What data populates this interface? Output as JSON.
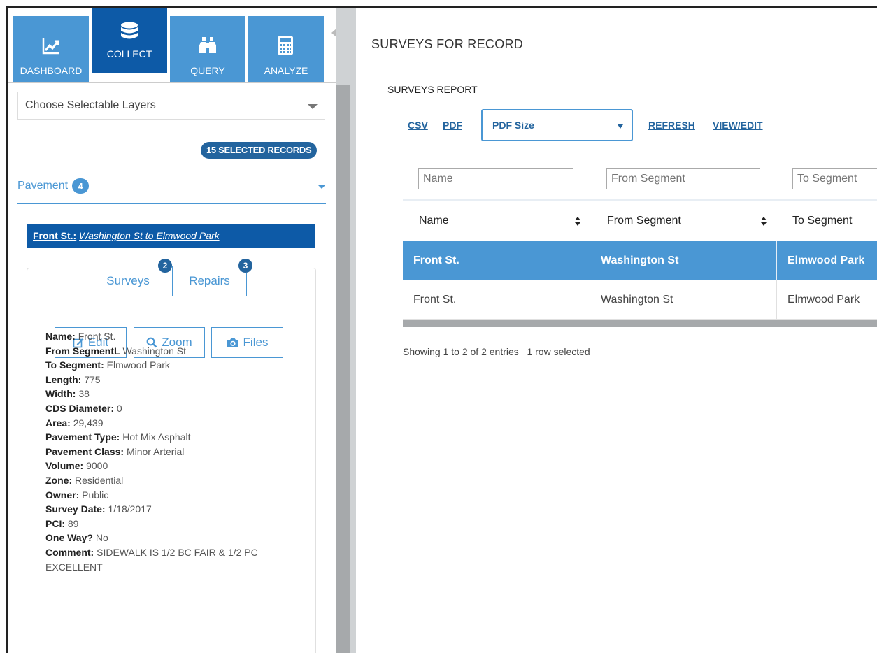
{
  "nav": {
    "dashboard": "DASHBOARD",
    "collect": "COLLECT",
    "query": "QUERY",
    "analyze": "ANALYZE"
  },
  "layers": {
    "placeholder": "Choose Selectable Layers"
  },
  "selected_records": "15 SELECTED RECORDS",
  "group": {
    "name": "Pavement",
    "count": "4"
  },
  "record": {
    "name": "Front St.:",
    "segment": "Washington St to Elmwood Park"
  },
  "actions": {
    "surveys": "Surveys",
    "surveys_count": "2",
    "repairs": "Repairs",
    "repairs_count": "3",
    "edit": "Edit",
    "zoom": "Zoom",
    "files": "Files"
  },
  "details": [
    {
      "label": "Name:",
      "value": "Front St."
    },
    {
      "label": "From SegmentL",
      "value": "Washington St"
    },
    {
      "label": "To Segment:",
      "value": "Elmwood Park"
    },
    {
      "label": "Length:",
      "value": "775"
    },
    {
      "label": "Width:",
      "value": "38"
    },
    {
      "label": "CDS Diameter:",
      "value": "0"
    },
    {
      "label": "Area:",
      "value": "29,439"
    },
    {
      "label": "Pavement Type:",
      "value": "Hot Mix Asphalt"
    },
    {
      "label": "Pavement Class:",
      "value": "Minor Arterial"
    },
    {
      "label": "Volume:",
      "value": "9000"
    },
    {
      "label": "Zone:",
      "value": "Residential"
    },
    {
      "label": "Owner:",
      "value": "Public"
    },
    {
      "label": "Survey Date:",
      "value": "1/18/2017"
    },
    {
      "label": "PCI:",
      "value": "89"
    },
    {
      "label": "One Way?",
      "value": "No"
    },
    {
      "label": "Comment:",
      "value": "SIDEWALK IS 1/2 BC FAIR & 1/2 PC EXCELLENT"
    }
  ],
  "panel": {
    "title": "SURVEYS FOR RECORD",
    "report_title": "SURVEYS REPORT",
    "csv": "CSV",
    "pdf": "PDF",
    "pdf_size": "PDF Size",
    "refresh": "REFRESH",
    "view_edit": "VIEW/EDIT"
  },
  "table": {
    "filters": [
      "Name",
      "From Segment",
      "To Segment"
    ],
    "headers": [
      "Name",
      "From Segment",
      "To Segment"
    ],
    "rows": [
      [
        "Front St.",
        "Washington St",
        "Elmwood Park"
      ],
      [
        "Front St.",
        "Washington St",
        "Elmwood Park"
      ]
    ],
    "info": "Showing 1 to 2 of 2 entries   1 row selected"
  },
  "colors": {
    "accent": "#4a97d4",
    "accent_dark": "#0d5aa7",
    "link": "#23649e"
  }
}
